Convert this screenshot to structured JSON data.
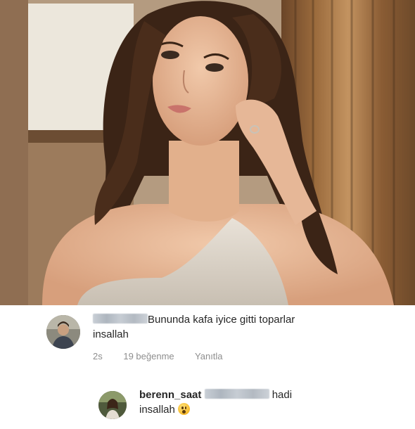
{
  "post": {
    "image_alt": ""
  },
  "comments": [
    {
      "text_line1": "Bununda kafa iyice gitti toparlar",
      "text_line2": "insallah",
      "time": "2s",
      "likes": "19 beğenme",
      "reply": "Yanıtla"
    },
    {
      "username": "berenn_saat",
      "text_after": "hadi",
      "text_line2": "insallah"
    }
  ],
  "icons": {
    "emoji": "hushed-face-icon"
  },
  "colors": {
    "text": "#262626",
    "meta": "#8e8e8e",
    "background": "#ffffff"
  }
}
